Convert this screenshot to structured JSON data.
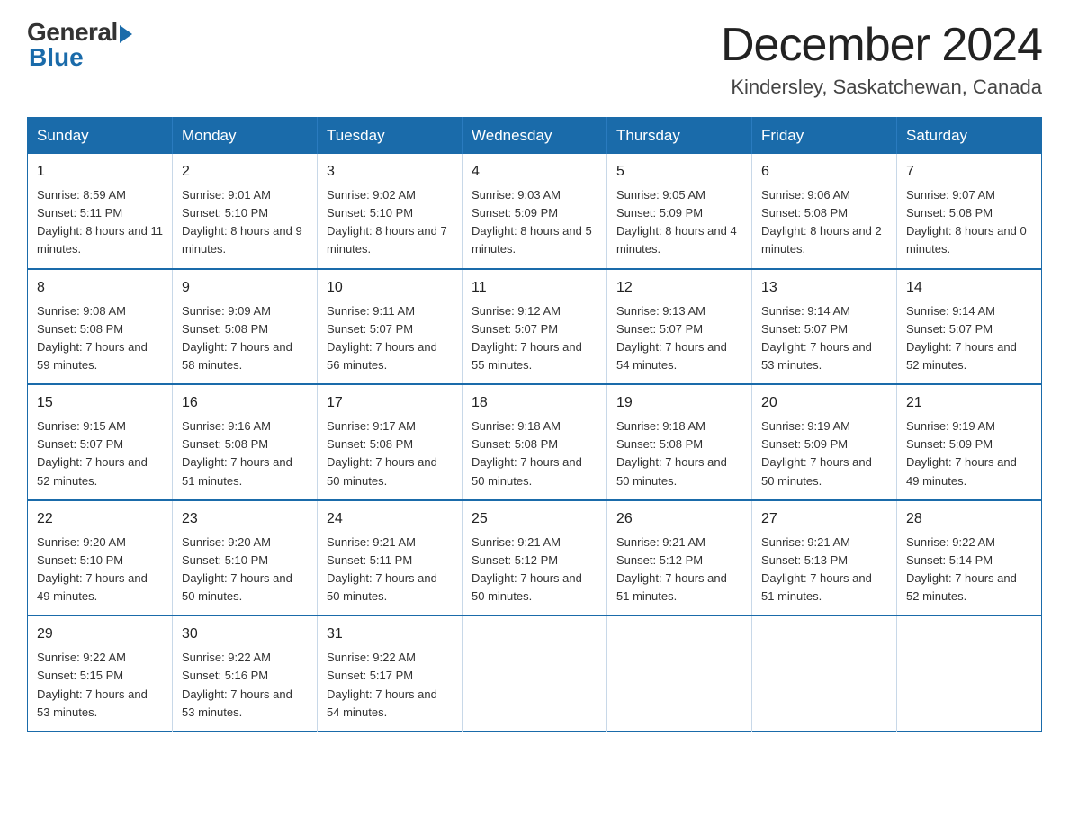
{
  "header": {
    "logo_general": "General",
    "logo_blue": "Blue",
    "month_title": "December 2024",
    "location": "Kindersley, Saskatchewan, Canada"
  },
  "days_of_week": [
    "Sunday",
    "Monday",
    "Tuesday",
    "Wednesday",
    "Thursday",
    "Friday",
    "Saturday"
  ],
  "weeks": [
    [
      {
        "day": "1",
        "sunrise": "8:59 AM",
        "sunset": "5:11 PM",
        "daylight": "8 hours and 11 minutes."
      },
      {
        "day": "2",
        "sunrise": "9:01 AM",
        "sunset": "5:10 PM",
        "daylight": "8 hours and 9 minutes."
      },
      {
        "day": "3",
        "sunrise": "9:02 AM",
        "sunset": "5:10 PM",
        "daylight": "8 hours and 7 minutes."
      },
      {
        "day": "4",
        "sunrise": "9:03 AM",
        "sunset": "5:09 PM",
        "daylight": "8 hours and 5 minutes."
      },
      {
        "day": "5",
        "sunrise": "9:05 AM",
        "sunset": "5:09 PM",
        "daylight": "8 hours and 4 minutes."
      },
      {
        "day": "6",
        "sunrise": "9:06 AM",
        "sunset": "5:08 PM",
        "daylight": "8 hours and 2 minutes."
      },
      {
        "day": "7",
        "sunrise": "9:07 AM",
        "sunset": "5:08 PM",
        "daylight": "8 hours and 0 minutes."
      }
    ],
    [
      {
        "day": "8",
        "sunrise": "9:08 AM",
        "sunset": "5:08 PM",
        "daylight": "7 hours and 59 minutes."
      },
      {
        "day": "9",
        "sunrise": "9:09 AM",
        "sunset": "5:08 PM",
        "daylight": "7 hours and 58 minutes."
      },
      {
        "day": "10",
        "sunrise": "9:11 AM",
        "sunset": "5:07 PM",
        "daylight": "7 hours and 56 minutes."
      },
      {
        "day": "11",
        "sunrise": "9:12 AM",
        "sunset": "5:07 PM",
        "daylight": "7 hours and 55 minutes."
      },
      {
        "day": "12",
        "sunrise": "9:13 AM",
        "sunset": "5:07 PM",
        "daylight": "7 hours and 54 minutes."
      },
      {
        "day": "13",
        "sunrise": "9:14 AM",
        "sunset": "5:07 PM",
        "daylight": "7 hours and 53 minutes."
      },
      {
        "day": "14",
        "sunrise": "9:14 AM",
        "sunset": "5:07 PM",
        "daylight": "7 hours and 52 minutes."
      }
    ],
    [
      {
        "day": "15",
        "sunrise": "9:15 AM",
        "sunset": "5:07 PM",
        "daylight": "7 hours and 52 minutes."
      },
      {
        "day": "16",
        "sunrise": "9:16 AM",
        "sunset": "5:08 PM",
        "daylight": "7 hours and 51 minutes."
      },
      {
        "day": "17",
        "sunrise": "9:17 AM",
        "sunset": "5:08 PM",
        "daylight": "7 hours and 50 minutes."
      },
      {
        "day": "18",
        "sunrise": "9:18 AM",
        "sunset": "5:08 PM",
        "daylight": "7 hours and 50 minutes."
      },
      {
        "day": "19",
        "sunrise": "9:18 AM",
        "sunset": "5:08 PM",
        "daylight": "7 hours and 50 minutes."
      },
      {
        "day": "20",
        "sunrise": "9:19 AM",
        "sunset": "5:09 PM",
        "daylight": "7 hours and 50 minutes."
      },
      {
        "day": "21",
        "sunrise": "9:19 AM",
        "sunset": "5:09 PM",
        "daylight": "7 hours and 49 minutes."
      }
    ],
    [
      {
        "day": "22",
        "sunrise": "9:20 AM",
        "sunset": "5:10 PM",
        "daylight": "7 hours and 49 minutes."
      },
      {
        "day": "23",
        "sunrise": "9:20 AM",
        "sunset": "5:10 PM",
        "daylight": "7 hours and 50 minutes."
      },
      {
        "day": "24",
        "sunrise": "9:21 AM",
        "sunset": "5:11 PM",
        "daylight": "7 hours and 50 minutes."
      },
      {
        "day": "25",
        "sunrise": "9:21 AM",
        "sunset": "5:12 PM",
        "daylight": "7 hours and 50 minutes."
      },
      {
        "day": "26",
        "sunrise": "9:21 AM",
        "sunset": "5:12 PM",
        "daylight": "7 hours and 51 minutes."
      },
      {
        "day": "27",
        "sunrise": "9:21 AM",
        "sunset": "5:13 PM",
        "daylight": "7 hours and 51 minutes."
      },
      {
        "day": "28",
        "sunrise": "9:22 AM",
        "sunset": "5:14 PM",
        "daylight": "7 hours and 52 minutes."
      }
    ],
    [
      {
        "day": "29",
        "sunrise": "9:22 AM",
        "sunset": "5:15 PM",
        "daylight": "7 hours and 53 minutes."
      },
      {
        "day": "30",
        "sunrise": "9:22 AM",
        "sunset": "5:16 PM",
        "daylight": "7 hours and 53 minutes."
      },
      {
        "day": "31",
        "sunrise": "9:22 AM",
        "sunset": "5:17 PM",
        "daylight": "7 hours and 54 minutes."
      },
      null,
      null,
      null,
      null
    ]
  ]
}
